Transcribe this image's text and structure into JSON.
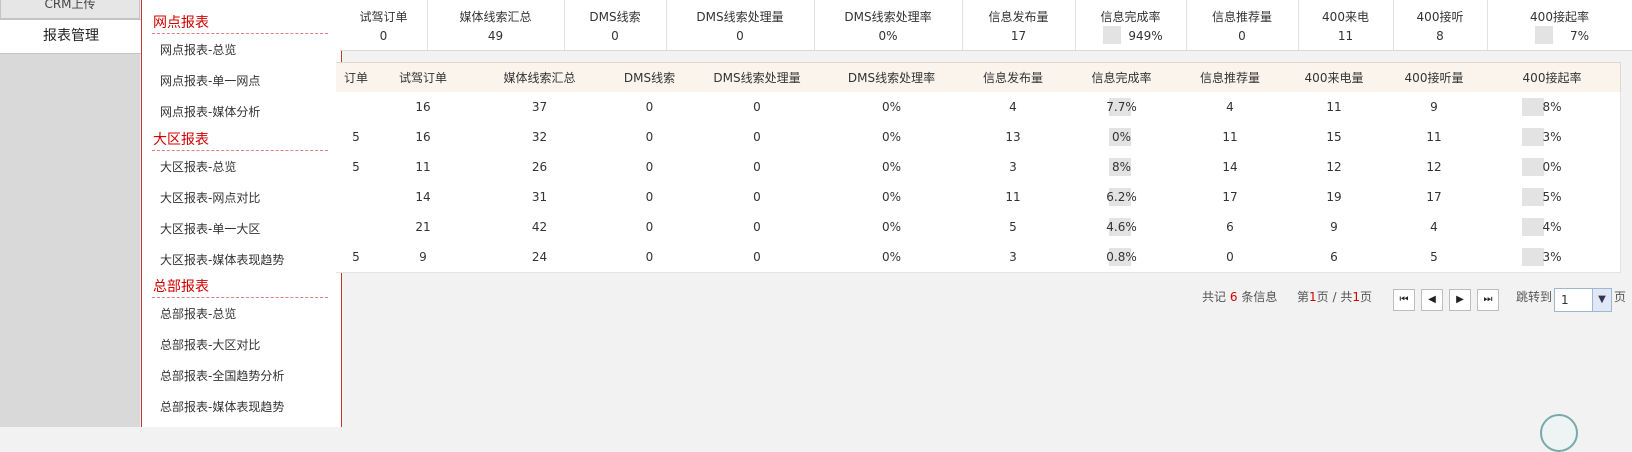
{
  "nav": {
    "crm_upload": "CRM上传",
    "report_mgmt": "报表管理"
  },
  "menu": {
    "groups": [
      {
        "title": "网点报表",
        "items": [
          "网点报表-总览",
          "网点报表-单一网点",
          "网点报表-媒体分析"
        ]
      },
      {
        "title": "大区报表",
        "items": [
          "大区报表-总览",
          "大区报表-网点对比",
          "大区报表-单一大区",
          "大区报表-媒体表现趋势"
        ]
      },
      {
        "title": "总部报表",
        "items": [
          "总部报表-总览",
          "总部报表-大区对比",
          "总部报表-全国趋势分析",
          "总部报表-媒体表现趋势"
        ]
      }
    ]
  },
  "summary": {
    "labels": [
      "试驾订单",
      "媒体线索汇总",
      "DMS线索",
      "DMS线索处理量",
      "DMS线索处理率",
      "信息发布量",
      "信息完成率",
      "信息推荐量",
      "400来电",
      "400接听",
      "400接起率"
    ],
    "values": [
      "0",
      "49",
      "0",
      "0",
      "0%",
      "17",
      "949%",
      "0",
      "11",
      "8",
      "7%"
    ]
  },
  "table": {
    "headers": [
      "订单",
      "试驾订单",
      "媒体线索汇总",
      "DMS线索",
      "DMS线索处理量",
      "DMS线索处理率",
      "信息发布量",
      "信息完成率",
      "信息推荐量",
      "400来电量",
      "400接听量",
      "400接起率"
    ],
    "rows": [
      [
        "",
        "16",
        "37",
        "0",
        "0",
        "0%",
        "4",
        "7.7%",
        "4",
        "11",
        "9",
        "8%"
      ],
      [
        "5",
        "16",
        "32",
        "0",
        "0",
        "0%",
        "13",
        "0%",
        "11",
        "15",
        "11",
        "3%"
      ],
      [
        "5",
        "11",
        "26",
        "0",
        "0",
        "0%",
        "3",
        "8%",
        "14",
        "12",
        "12",
        "0%"
      ],
      [
        "",
        "14",
        "31",
        "0",
        "0",
        "0%",
        "11",
        "6.2%",
        "17",
        "19",
        "17",
        "5%"
      ],
      [
        "",
        "21",
        "42",
        "0",
        "0",
        "0%",
        "5",
        "4.6%",
        "6",
        "9",
        "4",
        "4%"
      ],
      [
        "5",
        "9",
        "24",
        "0",
        "0",
        "0%",
        "3",
        "0.8%",
        "0",
        "6",
        "5",
        "3%"
      ]
    ]
  },
  "pager": {
    "total_prefix": "共记",
    "total_count": "6",
    "total_suffix": "条信息",
    "page_prefix": "第",
    "current_page": "1",
    "page_mid": "页 / 共",
    "total_pages": "1",
    "page_suffix": "页",
    "first_icon": "⏮",
    "prev_icon": "◀",
    "next_icon": "▶",
    "last_icon": "⏭",
    "jump_label": "跳转到",
    "jump_value": "1",
    "jump_suffix": "页"
  }
}
